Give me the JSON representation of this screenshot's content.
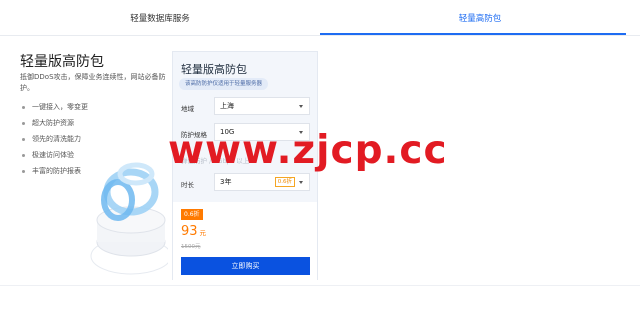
{
  "tabs": [
    {
      "label": "轻量数据库服务",
      "active": false
    },
    {
      "label": "轻量高防包",
      "active": true
    }
  ],
  "product": {
    "title": "轻量版高防包",
    "description": "抵御DDoS攻击，保障业务连续性，网站必备防护。",
    "features": [
      "一键接入，零变更",
      "超大防护资源",
      "领先的清洗能力",
      "极速访问体验",
      "丰富的防护报表"
    ]
  },
  "panel": {
    "title": "轻量版高防包",
    "note": "该高防防护仅适用于轻量服务器",
    "region": {
      "label": "地域",
      "value": "上海"
    },
    "spec": {
      "label": "防护规格",
      "value": "10G"
    },
    "muted_row": "弹性防护 / 2Gbps 以上",
    "duration": {
      "label": "时长",
      "value": "3年",
      "discount": "0.6折"
    }
  },
  "price": {
    "badge": "0.6折",
    "value": "93",
    "unit": "元",
    "original": "1500元",
    "buy_label": "立即购买"
  },
  "watermark": "www.zjcp.cc",
  "colors": {
    "accent": "#1e6cf2",
    "button": "#0a52e0",
    "price": "#ff7a00",
    "watermark": "#e21b23"
  },
  "icons": {
    "illustration": "shield-ring-illustration",
    "select": "chevron-down-icon"
  }
}
